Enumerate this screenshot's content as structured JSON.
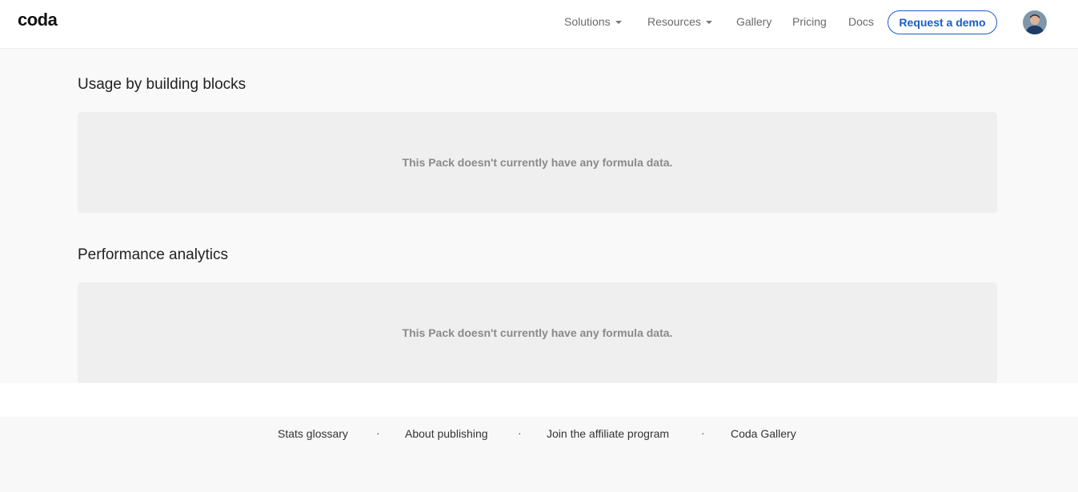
{
  "header": {
    "logo": "coda",
    "nav": [
      {
        "label": "Solutions",
        "has_dropdown": true
      },
      {
        "label": "Resources",
        "has_dropdown": true
      },
      {
        "label": "Gallery",
        "has_dropdown": false
      },
      {
        "label": "Pricing",
        "has_dropdown": false
      },
      {
        "label": "Docs",
        "has_dropdown": false
      }
    ],
    "cta_label": "Request a demo",
    "avatar_icon": "user-avatar-icon"
  },
  "sections": [
    {
      "title": "Usage by building blocks",
      "empty_message": "This Pack doesn't currently have any formula data."
    },
    {
      "title": "Performance analytics",
      "empty_message": "This Pack doesn't currently have any formula data."
    }
  ],
  "footer": {
    "links": [
      "Stats glossary",
      "About publishing",
      "Join the affiliate program",
      "Coda Gallery"
    ],
    "separator": "·"
  },
  "colors": {
    "accent": "#1b5cc8",
    "page_bg": "#f9f9f9",
    "box_bg": "#efefef"
  }
}
